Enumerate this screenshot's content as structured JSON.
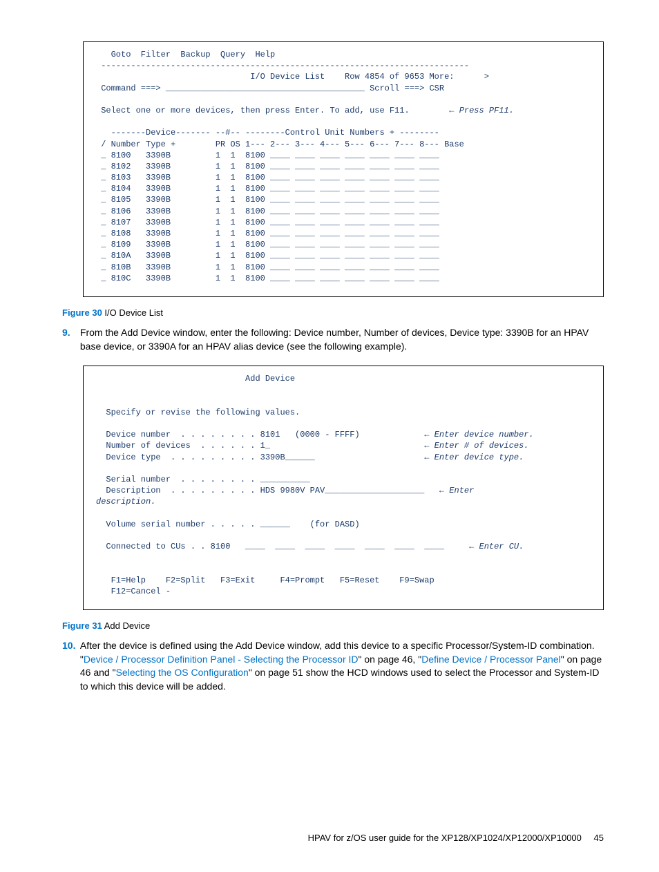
{
  "fig30": {
    "menu": "   Goto  Filter  Backup  Query  Help",
    "hr": " --------------------------------------------------------------------------",
    "title_row": "                               I/O Device List    Row 4854 of 9653 More:      >",
    "cmd_row": " Command ===> ________________________________________ Scroll ===> CSR",
    "blank": "",
    "select_row_a": " Select one or more devices, then press Enter. To add, use F11.        ",
    "select_row_b": "← Press PF11.",
    "hdr1": "   -------Device------- --#-- --------Control Unit Numbers + --------",
    "hdr2": " / Number Type +        PR OS 1--- 2--- 3--- 4--- 5--- 6--- 7--- 8--- Base",
    "rows": [
      " _ 8100   3390B         1  1  8100 ____ ____ ____ ____ ____ ____ ____",
      " _ 8102   3390B         1  1  8100 ____ ____ ____ ____ ____ ____ ____",
      " _ 8103   3390B         1  1  8100 ____ ____ ____ ____ ____ ____ ____",
      " _ 8104   3390B         1  1  8100 ____ ____ ____ ____ ____ ____ ____",
      " _ 8105   3390B         1  1  8100 ____ ____ ____ ____ ____ ____ ____",
      " _ 8106   3390B         1  1  8100 ____ ____ ____ ____ ____ ____ ____",
      " _ 8107   3390B         1  1  8100 ____ ____ ____ ____ ____ ____ ____",
      " _ 8108   3390B         1  1  8100 ____ ____ ____ ____ ____ ____ ____",
      " _ 8109   3390B         1  1  8100 ____ ____ ____ ____ ____ ____ ____",
      " _ 810A   3390B         1  1  8100 ____ ____ ____ ____ ____ ____ ____",
      " _ 810B   3390B         1  1  8100 ____ ____ ____ ____ ____ ____ ____",
      " _ 810C   3390B         1  1  8100 ____ ____ ____ ____ ____ ____ ____"
    ],
    "caption_label": "Figure 30",
    "caption_text": "I/O Device List"
  },
  "step9": {
    "num": "9.",
    "text": "From the Add Device window, enter the following: Device number, Number of devices, Device type: 3390B for an HPAV base device, or 3390A for an HPAV alias device (see the following example)."
  },
  "fig31": {
    "title": "                              Add Device",
    "blank": "",
    "spec": "  Specify or revise the following values.",
    "dn_a": "  Device number  . . . . . . . . 8101   (0000 - FFFF)             ",
    "dn_b": "← Enter device number.",
    "nd_a": "  Number of devices  . . . . . . 1_                               ",
    "nd_b": "← Enter # of devices.",
    "dt_a": "  Device type  . . . . . . . . . 3390B______                      ",
    "dt_b": "← Enter device type.",
    "sn": "  Serial number  . . . . . . . . __________",
    "desc_a": "  Description  . . . . . . . . . HDS 9980V PAV____________________   ",
    "desc_b": "← Enter",
    "desc2": "description.",
    "vsn": "  Volume serial number . . . . . ______    (for DASD)",
    "cu_a": "  Connected to CUs . . 8100   ____  ____  ____  ____  ____  ____  ____     ",
    "cu_b": "← Enter CU.",
    "fkeys1": "   F1=Help    F2=Split   F3=Exit     F4=Prompt   F5=Reset    F9=Swap",
    "fkeys2": "   F12=Cancel -",
    "caption_label": "Figure 31",
    "caption_text": "Add Device"
  },
  "step10": {
    "num": "10.",
    "text_a": "After the device is defined using the Add Device window, add this device to a specific Processor/System-ID combination. \"",
    "link1": "Device / Processor Definition Panel - Selecting the Processor ID",
    "text_b": "\" on page 46, \"",
    "link2": "Define Device / Processor Panel",
    "text_c": "\" on page 46 and \"",
    "link3": "Selecting the OS Configuration",
    "text_d": "\" on page 51 show the HCD windows used to select the Processor and System-ID to which this device will be added."
  },
  "footer": {
    "text": "HPAV for z/OS user guide for the XP128/XP1024/XP12000/XP10000",
    "page": "45"
  }
}
